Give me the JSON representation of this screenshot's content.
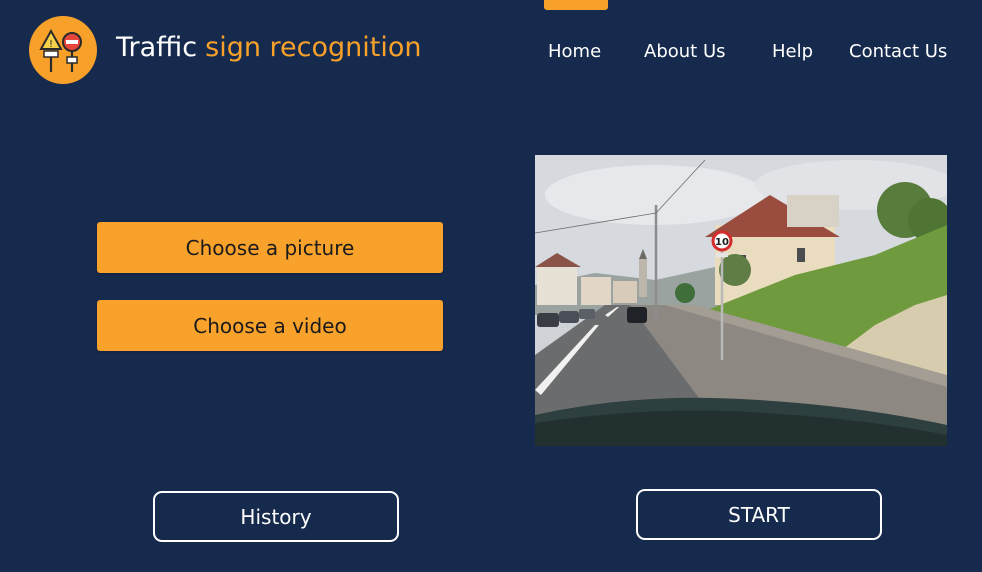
{
  "header": {
    "title_part1": "Traffic",
    "title_part2": "sign recognition",
    "logo_icon": "traffic-signs-icon"
  },
  "nav": {
    "items": [
      {
        "label": "Home",
        "active": true
      },
      {
        "label": "About Us"
      },
      {
        "label": "Help"
      },
      {
        "label": "Contact Us"
      }
    ]
  },
  "actions": {
    "choose_picture": "Choose a picture",
    "choose_video": "Choose a video",
    "history": "History",
    "start": "START"
  },
  "preview": {
    "content": "road-scene-photo",
    "speed_sign_value": "10"
  },
  "colors": {
    "background": "#162a4d",
    "accent": "#f7a12a",
    "text_light": "#ffffff"
  }
}
